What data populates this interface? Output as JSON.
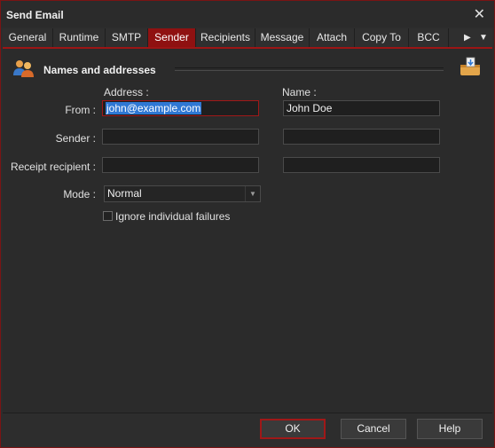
{
  "window": {
    "title": "Send Email",
    "close_glyph": "✕"
  },
  "tabs": [
    {
      "label": "General"
    },
    {
      "label": "Runtime"
    },
    {
      "label": "SMTP"
    },
    {
      "label": "Sender"
    },
    {
      "label": "Recipients"
    },
    {
      "label": "Message"
    },
    {
      "label": "Attach"
    },
    {
      "label": "Copy To"
    },
    {
      "label": "BCC"
    }
  ],
  "tab_nav": {
    "next_glyph": "▶",
    "menu_glyph": "▼"
  },
  "section": {
    "title": "Names and addresses",
    "icon": "people-icon",
    "action_icon": "mail-tray-icon"
  },
  "headers": {
    "address": "Address :",
    "name": "Name :"
  },
  "rows": {
    "from": {
      "label": "From :",
      "address": "john@example.com",
      "name": "John Doe"
    },
    "sender": {
      "label": "Sender :",
      "address": "",
      "name": ""
    },
    "receipt": {
      "label": "Receipt recipient :",
      "address": "",
      "name": ""
    }
  },
  "mode": {
    "label": "Mode :",
    "value": "Normal"
  },
  "ignore_failures": {
    "label": "Ignore individual failures",
    "checked": false
  },
  "buttons": {
    "ok": "OK",
    "cancel": "Cancel",
    "help": "Help"
  },
  "colors": {
    "accent": "#8f1111",
    "selection": "#2f78d4",
    "background": "#2b2b2b"
  }
}
